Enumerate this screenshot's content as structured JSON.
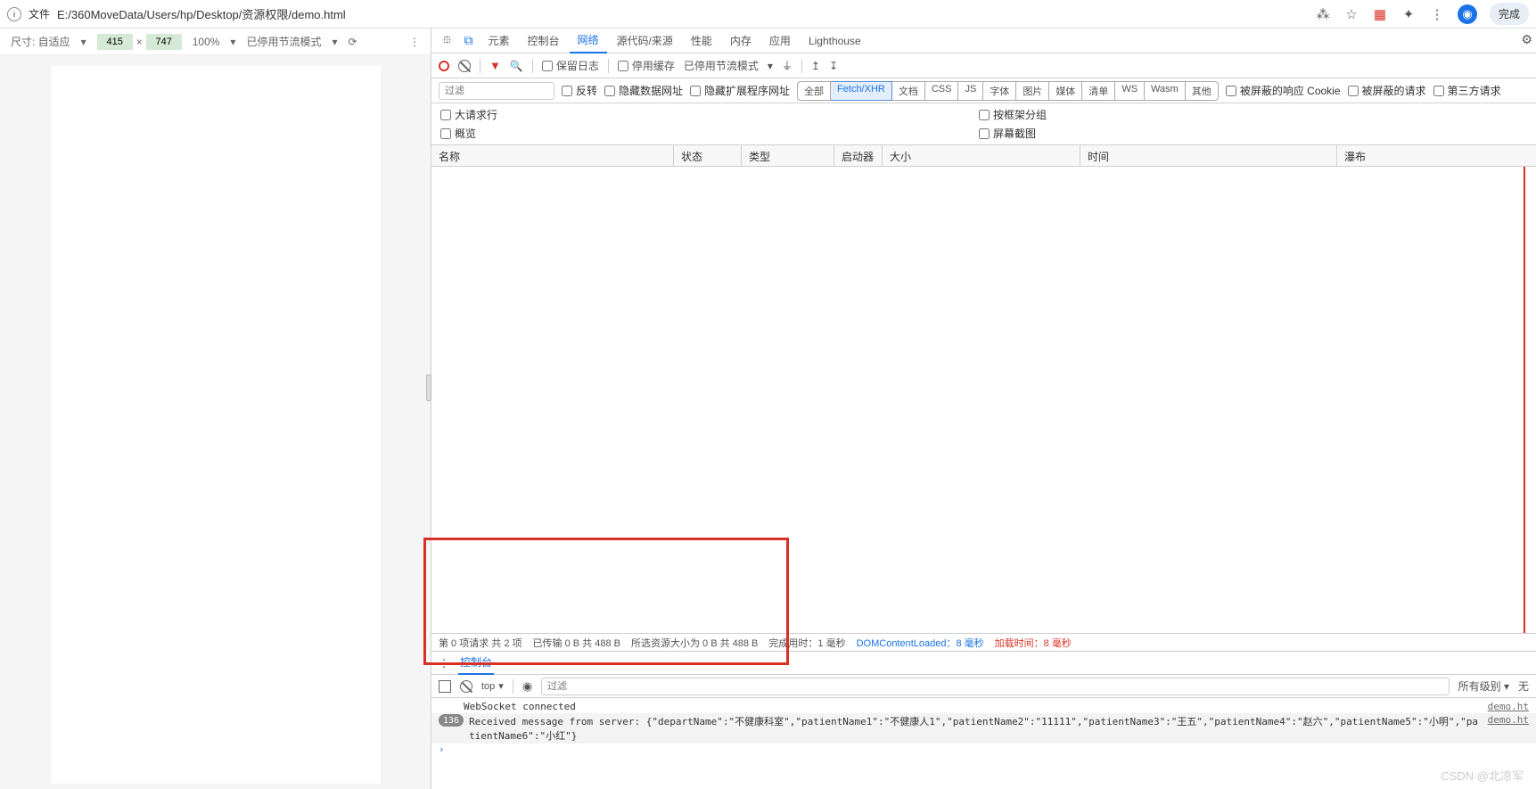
{
  "addr": {
    "file_label": "文件",
    "path": "E:/360MoveData/Users/hp/Desktop/资源权限/demo.html",
    "done": "完成"
  },
  "device_tb": {
    "size_label": "尺寸: 自适应",
    "w": "415",
    "x": "×",
    "h": "747",
    "zoom": "100%",
    "throttle": "已停用节流模式"
  },
  "tabs": {
    "elements": "元素",
    "console": "控制台",
    "network": "网络",
    "sources": "源代码/来源",
    "perf": "性能",
    "memory": "内存",
    "app": "应用",
    "lh": "Lighthouse"
  },
  "tools": {
    "preserve": "保留日志",
    "disable_cache": "停用缓存",
    "throttle": "已停用节流模式"
  },
  "row2": {
    "filter_ph": "过滤",
    "invert": "反转",
    "hide_data": "隐藏数据网址",
    "hide_ext": "隐藏扩展程序网址",
    "chips": [
      "全部",
      "Fetch/XHR",
      "文档",
      "CSS",
      "JS",
      "字体",
      "图片",
      "媒体",
      "清单",
      "WS",
      "Wasm",
      "其他"
    ],
    "blocked_cookies": "被屏蔽的响应 Cookie",
    "blocked_req": "被屏蔽的请求",
    "third_party": "第三方请求"
  },
  "row3": {
    "big_row": "大请求行",
    "by_frame": "按框架分组",
    "overview": "概览",
    "screenshot": "屏幕截图"
  },
  "net_hdr": {
    "name": "名称",
    "status": "状态",
    "type": "类型",
    "initiator": "启动器",
    "size": "大小",
    "time": "时间",
    "waterfall": "瀑布"
  },
  "net_foot": {
    "req": "第 0 项请求  共 2 项",
    "xfer": "已传输 0 B  共 488 B",
    "res": "所选资源大小为 0 B  共 488 B",
    "finish": "完成用时：1 毫秒",
    "dcl": "DOMContentLoaded：8 毫秒",
    "load": "加载时间：8 毫秒"
  },
  "drawer": {
    "console": "控制台"
  },
  "con_tb": {
    "top": "top",
    "filter_ph": "过滤",
    "levels": "所有级别",
    "no_issues": "无"
  },
  "console_rows": [
    {
      "badge": "",
      "text": "WebSocket connected",
      "src": "demo.ht"
    },
    {
      "badge": "136",
      "text": "Received message from server: {\"departName\":\"不健康科室\",\"patientName1\":\"不健康人1\",\"patientName2\":\"11111\",\"patientName3\":\"王五\",\"patientName4\":\"赵六\",\"patientName5\":\"小明\",\"patientName6\":\"小红\"}",
      "src": "demo.ht"
    }
  ],
  "watermark": "CSDN @北凉军"
}
